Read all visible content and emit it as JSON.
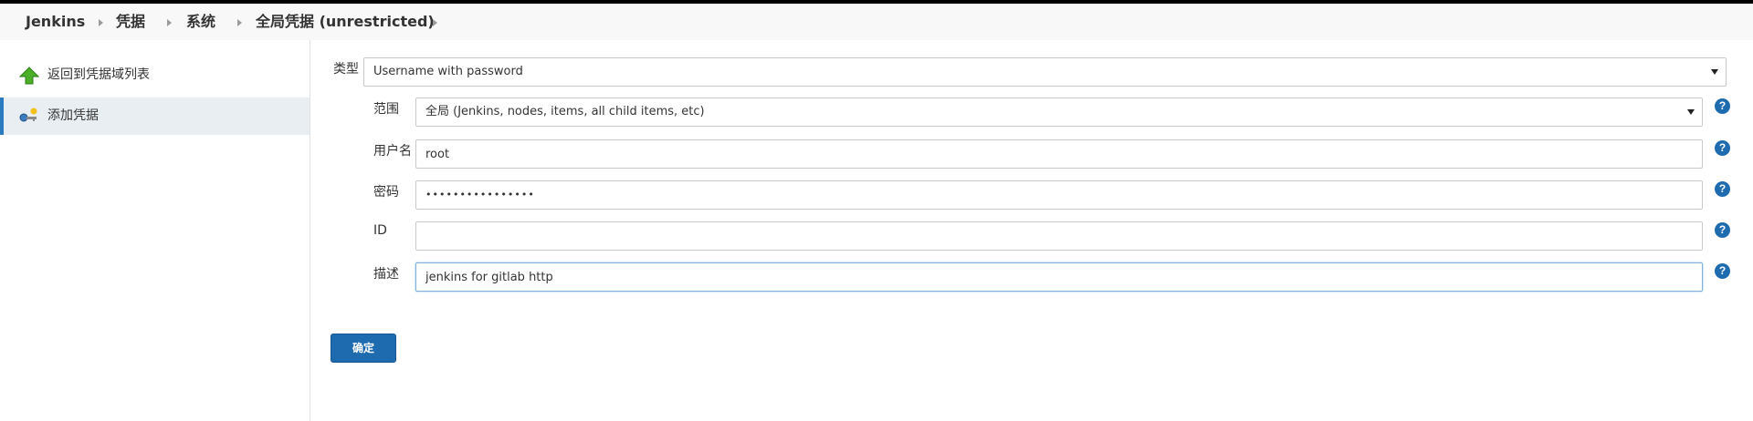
{
  "breadcrumbs": [
    "Jenkins",
    "凭据",
    "系统",
    "全局凭据 (unrestricted)"
  ],
  "sidebar": {
    "items": [
      {
        "label": "返回到凭据域列表",
        "icon": "up-arrow-icon"
      },
      {
        "label": "添加凭据",
        "icon": "key-add-icon"
      }
    ]
  },
  "form": {
    "kind": {
      "label": "类型",
      "value": "Username with password"
    },
    "scope": {
      "label": "范围",
      "value": "全局 (Jenkins, nodes, items, all child items, etc)"
    },
    "username": {
      "label": "用户名",
      "value": "root"
    },
    "password": {
      "label": "密码",
      "value": "••••••••••••••••"
    },
    "id": {
      "label": "ID",
      "value": ""
    },
    "description": {
      "label": "描述",
      "value": "jenkins for gitlab http"
    },
    "help_glyph": "?",
    "submit_label": "确定"
  },
  "colors": {
    "accent": "#1f6bb0",
    "sidebar_active": "#e8eef2",
    "arrow_green": "#4caf2a"
  }
}
